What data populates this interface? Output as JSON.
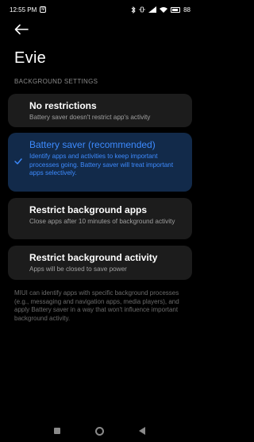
{
  "status_bar": {
    "time": "12:55 PM",
    "notification_badge": "M",
    "battery_text": "88",
    "battery_level": 0.88
  },
  "header": {
    "title": "Evie"
  },
  "section": {
    "header": "BACKGROUND SETTINGS"
  },
  "options": [
    {
      "title": "No restrictions",
      "description": "Battery saver doesn't restrict app's activity",
      "selected": false
    },
    {
      "title": "Battery saver (recommended)",
      "description": "Identify apps and activities to keep important processes going. Battery saver will treat important apps selectively.",
      "selected": true
    },
    {
      "title": "Restrict background apps",
      "description": "Close apps after 10 minutes of background activity",
      "selected": false
    },
    {
      "title": "Restrict background activity",
      "description": "Apps will be closed to save power",
      "selected": false
    }
  ],
  "footer_note": "MIUI can identify apps with specific background processes (e.g., messaging and navigation apps, media players), and apply Battery saver in a way that won't influence important background activity.",
  "colors": {
    "accent": "#3d8bff",
    "selected_card_bg": "#122a4a",
    "card_bg": "#1c1c1c",
    "background": "#000000"
  },
  "icons": {
    "back": "arrow-left-icon",
    "check": "checkmark-icon",
    "nav": [
      "recents-icon",
      "home-icon",
      "back-triangle-icon"
    ]
  }
}
